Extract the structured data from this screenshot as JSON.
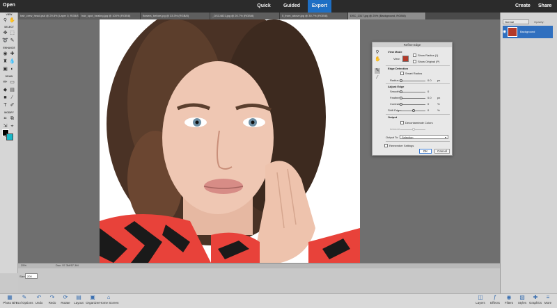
{
  "topbar": {
    "open_label": "Open",
    "tabs": [
      "Quick",
      "Guided",
      "Export"
    ],
    "create_label": "Create",
    "share_label": "Share"
  },
  "doc_tabs": [
    "hair_crew_head.psd @ 29.8% (Layer 0, RGB/8)",
    "hair_spot_healing.jpg @ 100% (RGB/8)",
    "flowers_before.jpg @ 33.3% (RGB/8)",
    "_DSC4821.jpg @ 20.7% (RGB/8)",
    "5_from_above.jpg @ 30.7% (RGB/8)",
    "DSC_2317.jpg @ 25% (Background, RGB/8)"
  ],
  "toolbox": {
    "sections": [
      "VIEW",
      "SELECT",
      "ENHANCE",
      "DRAW",
      "MODIFY",
      "COLOR"
    ]
  },
  "status": {
    "zoom": "25%",
    "doc": "Doc: 57.3M/57.3M"
  },
  "tool_options": {
    "size_label": "Size:",
    "size_value": "200"
  },
  "layers_panel": {
    "blend_mode": "Normal",
    "opacity_label": "Opacity:",
    "layer_name": "Background"
  },
  "refine_edge": {
    "title": "Refine Edge",
    "view_mode": {
      "heading": "View Mode",
      "view_label": "View:",
      "show_radius": "Show Radius (J)",
      "show_original": "Show Original (P)"
    },
    "edge_detection": {
      "heading": "Edge Detection",
      "smart_radius": "Smart Radius",
      "radius_label": "Radius:",
      "radius_value": "0.0",
      "radius_unit": "px"
    },
    "adjust_edge": {
      "heading": "Adjust Edge",
      "smooth": {
        "label": "Smooth:",
        "value": "0"
      },
      "feather": {
        "label": "Feather:",
        "value": "0.0",
        "unit": "px"
      },
      "contrast": {
        "label": "Contrast:",
        "value": "0",
        "unit": "%"
      },
      "shift_edge": {
        "label": "Shift Edge:",
        "value": "0",
        "unit": "%"
      }
    },
    "output": {
      "heading": "Output",
      "decontaminate": "Decontaminate Colors",
      "amount_label": "Amount:",
      "output_to_label": "Output To:",
      "output_to_value": "Selection"
    },
    "remember_settings": "Remember Settings",
    "ok_label": "OK",
    "cancel_label": "Cancel"
  },
  "bottom_bar": {
    "left": [
      "Photo Bin",
      "Tool Options",
      "Undo",
      "Redo",
      "Rotate",
      "Layout",
      "Organizer",
      "Home Screen"
    ],
    "right": [
      "Layers",
      "Effects",
      "Filters",
      "Styles",
      "Graphics",
      "More"
    ]
  },
  "colors": {
    "accent": "#1e6fc4",
    "foreground": "#000000",
    "background": "#19b9c8"
  }
}
